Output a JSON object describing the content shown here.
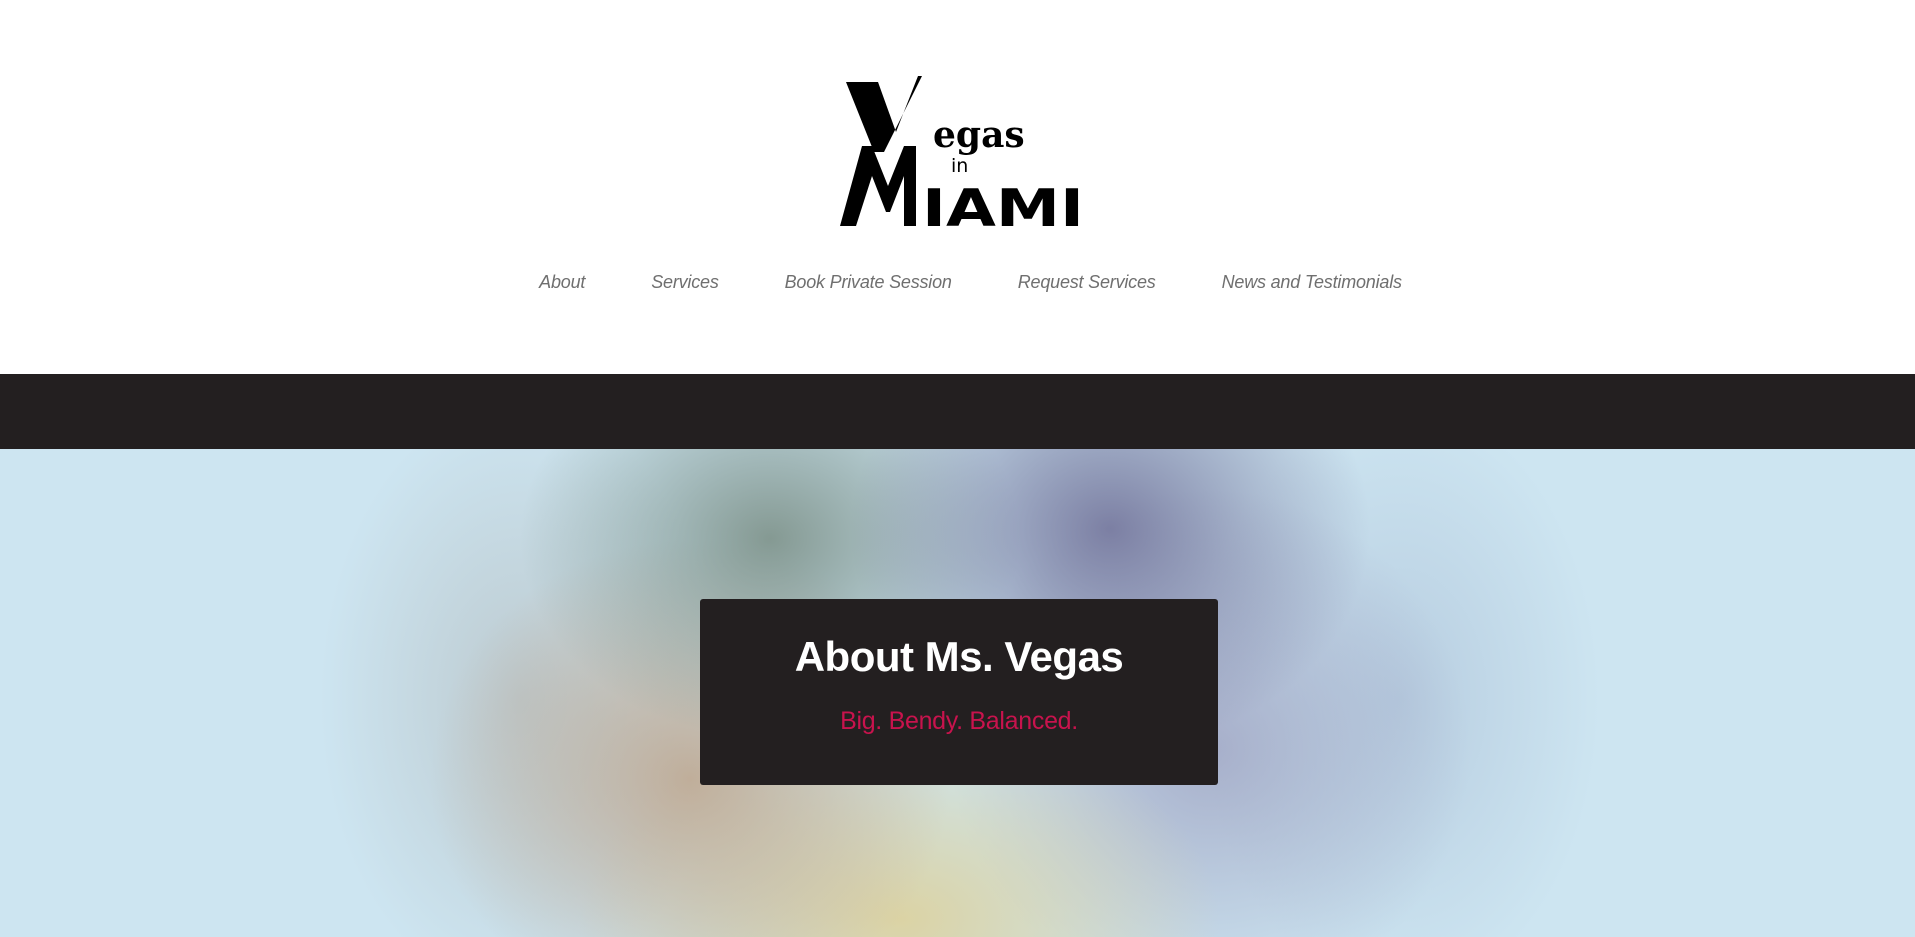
{
  "brand": {
    "logo_text": "Vegas in Miami",
    "logo_letters": {
      "big_v": "V",
      "egas": "egas",
      "in": "in",
      "big_m": "M",
      "iami": "IAMI"
    }
  },
  "nav": {
    "items": [
      {
        "label": "About"
      },
      {
        "label": "Services"
      },
      {
        "label": "Book Private Session"
      },
      {
        "label": "Request Services"
      },
      {
        "label": "News and Testimonials"
      }
    ]
  },
  "hero": {
    "title": "About Ms. Vegas",
    "subtitle": "Big. Bendy. Balanced."
  },
  "colors": {
    "dark_band": "#231f20",
    "nav_text": "#6f6f6f",
    "accent": "#c8134d",
    "hero_bg": "#cde5f1"
  }
}
